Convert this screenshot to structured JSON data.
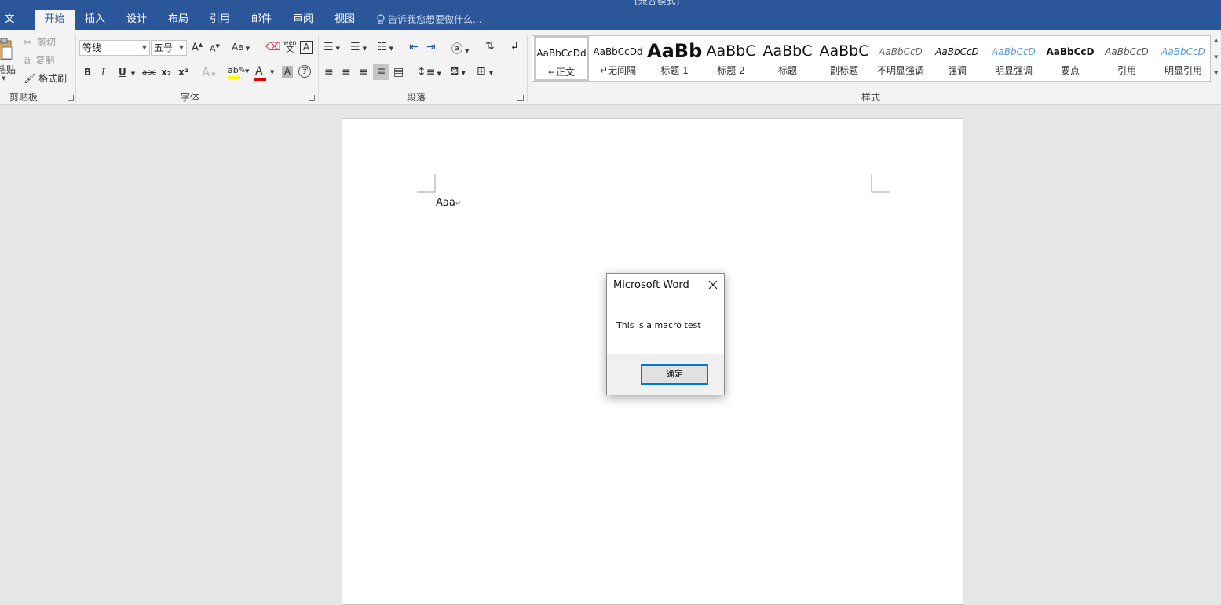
{
  "window": {
    "title": "[兼容模式]"
  },
  "tabs": [
    "文件",
    "开始",
    "插入",
    "设计",
    "布局",
    "引用",
    "邮件",
    "审阅",
    "视图"
  ],
  "active_tab": "开始",
  "tell_me": "告诉我您想要做什么...",
  "clipboard": {
    "paste": "粘贴",
    "cut": "剪切",
    "copy": "复制",
    "format_painter": "格式刷",
    "group": "剪贴板"
  },
  "font": {
    "name": "等线",
    "size": "五号",
    "group": "字体",
    "change_case": "Aa",
    "bold": "B",
    "italic": "I",
    "underline": "U",
    "strike": "abc",
    "subscript": "x₂",
    "superscript": "x²",
    "phonetic_top": "wén",
    "phonetic_bottom": "文",
    "enclose": "字"
  },
  "paragraph": {
    "group": "段落"
  },
  "styles": {
    "group": "样式",
    "items": [
      {
        "preview": "AaBbCcDd",
        "name": "↵正文"
      },
      {
        "preview": "AaBbCcDd",
        "name": "↵无间隔"
      },
      {
        "preview": "AaBb",
        "name": "标题 1"
      },
      {
        "preview": "AaBbC",
        "name": "标题 2"
      },
      {
        "preview": "AaBbC",
        "name": "标题"
      },
      {
        "preview": "AaBbC",
        "name": "副标题"
      },
      {
        "preview": "AaBbCcD",
        "name": "不明显强调"
      },
      {
        "preview": "AaBbCcD",
        "name": "强调"
      },
      {
        "preview": "AaBbCcD",
        "name": "明显强调"
      },
      {
        "preview": "AaBbCcD",
        "name": "要点"
      },
      {
        "preview": "AaBbCcD",
        "name": "引用"
      },
      {
        "preview": "AaBbCcD",
        "name": "明显引用"
      }
    ]
  },
  "document": {
    "text": "Aaa",
    "para_mark": "↵"
  },
  "dialog": {
    "title": "Microsoft Word",
    "message": "This is a macro test",
    "ok": "确定"
  },
  "colors": {
    "accent": "#2b579a",
    "highlight": "#ffff00",
    "font_color": "#e00000",
    "dialog_button_border": "#0078d7",
    "emphasis_blue": "#5b9bd5"
  }
}
